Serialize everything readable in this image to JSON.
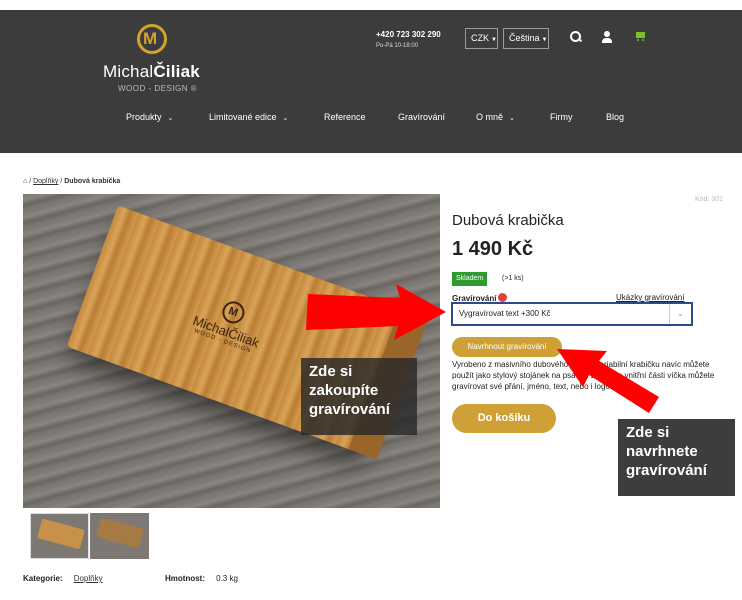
{
  "header": {
    "logo_mark": "M",
    "logo_first": "Michal",
    "logo_last": "Čiliak",
    "logo_sub": "WOOD - DESIGN ®",
    "phone": "+420 723 302 290",
    "hours": "Po-Pá 10-18:00",
    "currency": "CZK",
    "language": "Čeština",
    "accent_color": "#d2a330",
    "cart_color": "#7bbf2a"
  },
  "nav": [
    {
      "label": "Produkty",
      "has_dropdown": true
    },
    {
      "label": "Limitované edice",
      "has_dropdown": true
    },
    {
      "label": "Reference",
      "has_dropdown": false
    },
    {
      "label": "Gravírování",
      "has_dropdown": false
    },
    {
      "label": "O mně",
      "has_dropdown": true
    },
    {
      "label": "Firmy",
      "has_dropdown": false
    },
    {
      "label": "Blog",
      "has_dropdown": false
    }
  ],
  "breadcrumb": {
    "separator": "/",
    "category": "Doplňky",
    "current": "Dubová krabička"
  },
  "product": {
    "code": "Kód: 301",
    "title": "Dubová krabička",
    "price": "1 490 Kč",
    "stock_label": "Skladem",
    "stock_count": "(>1 ks)",
    "engraving_label": "Gravírování",
    "samples_link": "Ukázky gravírování",
    "engraving_option": "Vygravírovat text +300 Kč",
    "design_button": "Navrhnout gravírování",
    "description": "Vyrobeno z masivního dubového dřeva. Variabilní krabičku navíc můžete použít jako stylový stojánek na psacím stole! Na vnitřní části víčka můžete gravírovat své přání, jméno, text, nebo i logo.",
    "cart_button": "Do košíku",
    "image_engraving_name": "MichalČiliak",
    "image_engraving_sub": "WOOD - DESIGN"
  },
  "annotations": {
    "left": "Zde si zakoupíte gravírování",
    "right": "Zde si navrhnete gravírování",
    "arrow_color": "#ff0000"
  },
  "meta": {
    "category_label": "Kategorie:",
    "category_value": "Doplňky",
    "weight_label": "Hmotnost:",
    "weight_value": "0.3 kg"
  }
}
